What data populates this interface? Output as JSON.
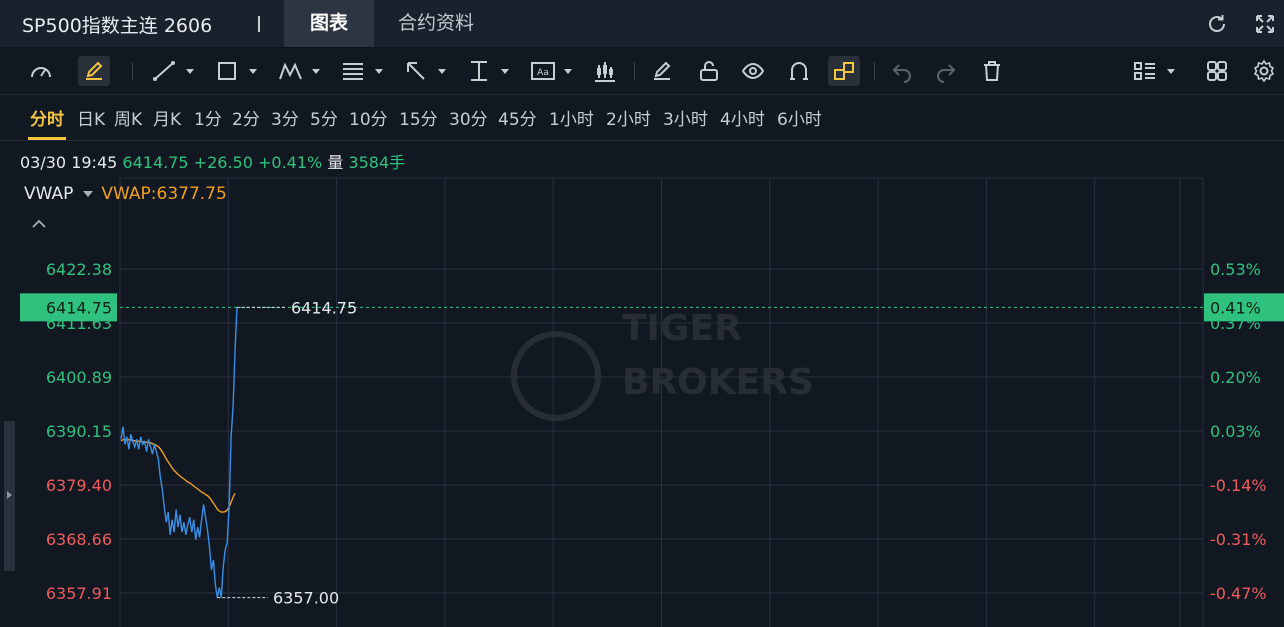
{
  "header": {
    "title": "SP500指数主连 2606",
    "tabs": [
      {
        "label": "图表",
        "active": true
      },
      {
        "label": "合约资料",
        "active": false
      }
    ],
    "icons": [
      "refresh-icon",
      "fullscreen-icon"
    ]
  },
  "toolbar": {
    "icons": [
      "gauge-icon",
      "pen-icon",
      "line-icon",
      "rect-icon",
      "wave-icon",
      "fib-icon",
      "arrow-icon",
      "vertical-measure-icon",
      "text-icon",
      "candle-icon",
      "eraser-pen-icon",
      "lock-icon",
      "eye-icon",
      "magnet-icon",
      "link-icon",
      "undo-icon",
      "redo-icon",
      "trash-icon",
      "list-icon",
      "grid-icon",
      "settings-icon"
    ]
  },
  "periods": [
    "分时",
    "日K",
    "周K",
    "月K",
    "1分",
    "2分",
    "3分",
    "5分",
    "10分",
    "15分",
    "30分",
    "45分",
    "1小时",
    "2小时",
    "3小时",
    "4小时",
    "6小时"
  ],
  "active_period": "分时",
  "quote": {
    "datetime": "03/30 19:45",
    "price": "6414.75",
    "change": "+26.50",
    "change_pct": "+0.41%",
    "volume_label": "量",
    "volume": "3584手"
  },
  "indicator": {
    "name": "VWAP",
    "value": "VWAP:6377.75"
  },
  "colors": {
    "up": "#2ec27e",
    "down": "#ee5b5b",
    "price_line": "#3a8ee6",
    "vwap_line": "#f0a020",
    "accent": "#f5c542",
    "background": "#121821"
  },
  "chart_data": {
    "type": "line",
    "reference_price": 6388.25,
    "current_price": 6414.75,
    "current_price_label": "6414.75",
    "current_pct_label": "0.41%",
    "low_price": 6357.0,
    "low_price_label": "6357.00",
    "ylim": [
      6357.91,
      6422.38
    ],
    "left_ticks": [
      6422.38,
      6411.63,
      6400.89,
      6390.15,
      6379.4,
      6368.66,
      6357.91
    ],
    "left_tick_labels": [
      "6422.38",
      "6411.63",
      "6400.89",
      "6390.15",
      "6379.40",
      "6368.66",
      "6357.91"
    ],
    "right_tick_labels": [
      "0.53%",
      "0.37%",
      "0.20%",
      "0.03%",
      "-0.14%",
      "-0.31%",
      "-0.47%"
    ],
    "grid": true,
    "x_sessions": 10,
    "series": [
      {
        "key": "price",
        "values": [
          6388.5,
          6391.0,
          6387.5,
          6389.0,
          6386.5,
          6389.5,
          6388.0,
          6387.0,
          6388.5,
          6386.5,
          6389.0,
          6387.5,
          6388.0,
          6386.0,
          6388.5,
          6387.0,
          6385.5,
          6387.5,
          6386.0,
          6384.5,
          6381.0,
          6378.5,
          6375.0,
          6372.0,
          6374.0,
          6369.5,
          6372.5,
          6370.0,
          6374.5,
          6371.0,
          6373.5,
          6370.0,
          6372.0,
          6369.5,
          6371.5,
          6373.0,
          6370.0,
          6372.5,
          6368.5,
          6371.0,
          6369.0,
          6372.5,
          6375.5,
          6373.0,
          6370.5,
          6367.0,
          6362.5,
          6364.5,
          6359.5,
          6357.0,
          6359.0,
          6357.0,
          6363.0,
          6366.5,
          6368.0,
          6375.0,
          6389.0,
          6395.0,
          6406.0,
          6414.75
        ]
      },
      {
        "key": "vwap",
        "values": [
          6388.2,
          6388.4,
          6388.5,
          6388.5,
          6388.4,
          6388.4,
          6388.3,
          6388.2,
          6388.2,
          6388.1,
          6388.1,
          6388.0,
          6388.0,
          6387.9,
          6387.9,
          6387.8,
          6387.6,
          6387.5,
          6387.3,
          6387.0,
          6386.6,
          6386.0,
          6385.3,
          6384.6,
          6384.0,
          6383.4,
          6382.8,
          6382.3,
          6381.9,
          6381.5,
          6381.2,
          6380.9,
          6380.6,
          6380.3,
          6380.0,
          6379.8,
          6379.5,
          6379.2,
          6378.9,
          6378.6,
          6378.3,
          6378.0,
          6377.8,
          6377.5,
          6377.3,
          6376.9,
          6376.4,
          6375.8,
          6375.2,
          6374.6,
          6374.2,
          6374.0,
          6374.0,
          6374.1,
          6374.4,
          6375.0,
          6376.0,
          6377.0,
          6377.75
        ]
      }
    ]
  },
  "watermark": {
    "line1": "TIGER",
    "line2": "BROKERS"
  }
}
